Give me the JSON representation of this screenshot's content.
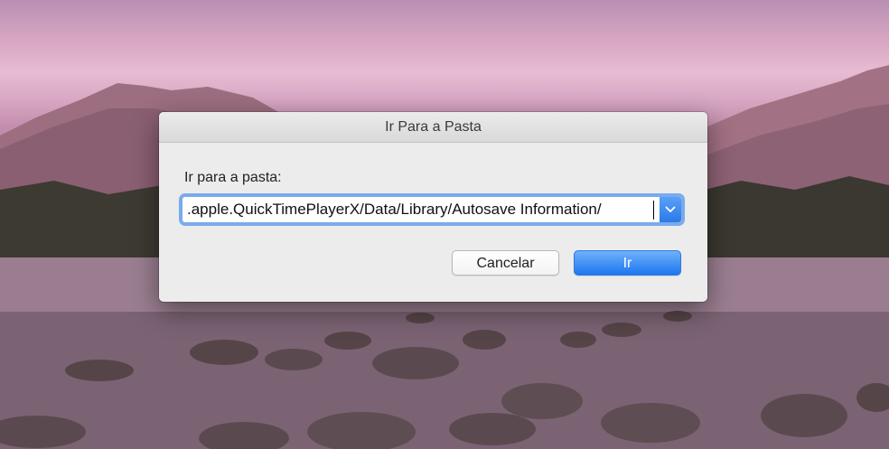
{
  "dialog": {
    "title": "Ir Para a Pasta",
    "prompt_label": "Ir para a pasta:",
    "path_value": ".apple.QuickTimePlayerX/Data/Library/Autosave Information/",
    "cancel_label": "Cancelar",
    "go_label": "Ir"
  },
  "colors": {
    "accent": "#1c76f0",
    "dialog_background": "#ececec"
  },
  "icons": {
    "combo_button": "chevron-down-icon"
  }
}
